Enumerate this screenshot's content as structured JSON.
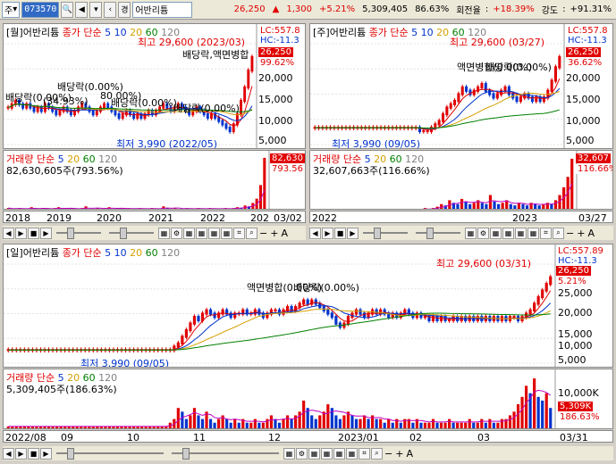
{
  "toolbar": {
    "mode": "주",
    "code": "073570",
    "icon_badge": "경",
    "name": "어반리튬",
    "price": "26,250",
    "arrow": "▲",
    "change": "1,300",
    "rate": "+5.21%",
    "volume": "5,309,405",
    "vol_ratio": "86.63%",
    "turnover_label": "회전율",
    "turnover": "+18.39%",
    "strength_label": "강도",
    "strength": "+91.31%"
  },
  "panels": {
    "monthly": {
      "title": "[월]어반리튬",
      "ma_label": "종가 단순",
      "ma": [
        "5",
        "10",
        "20",
        "60",
        "120"
      ],
      "high": "최고 29,600 (2023/03)",
      "low": "최저 3,990 (2022/05)",
      "anns": [
        "배당락,액면병합",
        "배당락(0.00%)",
        "배당락(0.00%)",
        "배당락(0.00%)",
        "배당락(0.00%)",
        "(34.93%)",
        "80.00%)"
      ],
      "lc": "LC:557.8",
      "hc": "HC:-11.3",
      "price_tag": "26,250",
      "pct_tag": "99.62%",
      "y": [
        "20,000",
        "15,000",
        "10,000",
        "5,000"
      ],
      "vol_title": "거래량",
      "vol_ma_label": "단순",
      "vol_ma": [
        "5",
        "20",
        "60",
        "120"
      ],
      "vol_value": "82,630,605주(793.56%)",
      "vol_tag": "82,630",
      "vol_pct_tag": "793.56",
      "x": [
        "2018",
        "2019",
        "2020",
        "2021",
        "2022",
        "202"
      ],
      "x_right": "03/02",
      "candles": [
        11,
        12,
        13,
        12,
        11,
        12,
        11,
        10,
        11,
        10,
        12,
        11,
        10,
        9,
        10,
        11,
        10,
        9,
        10,
        11,
        12,
        11,
        10,
        9,
        10,
        11,
        12,
        11,
        10,
        9,
        8,
        9,
        10,
        9,
        8,
        9,
        8,
        9,
        10,
        9,
        10,
        11,
        12,
        11,
        10,
        11,
        12,
        11,
        10,
        9,
        10,
        11,
        10,
        9,
        8,
        9,
        8,
        7,
        6,
        5,
        4,
        6,
        9,
        13,
        17,
        22,
        26
      ],
      "vols": [
        3,
        2,
        2,
        3,
        2,
        2,
        4,
        2,
        2,
        3,
        2,
        2,
        3,
        4,
        2,
        2,
        3,
        2,
        2,
        3,
        5,
        2,
        2,
        3,
        2,
        3,
        4,
        2,
        2,
        3,
        2,
        3,
        2,
        2,
        3,
        2,
        2,
        3,
        2,
        2,
        5,
        3,
        2,
        3,
        2,
        2,
        3,
        2,
        2,
        3,
        2,
        2,
        3,
        2,
        2,
        2,
        3,
        2,
        3,
        4,
        3,
        6,
        5,
        9,
        14,
        30,
        62
      ]
    },
    "weekly": {
      "title": "[주]어반리튬",
      "ma_label": "종가 단순",
      "ma": [
        "5",
        "10",
        "20",
        "60",
        "120"
      ],
      "high": "최고 29,600 (03/27)",
      "low": "최저 3,990 (09/05)",
      "anns": [
        "액면병합(0.00%)",
        "배당락(0.00%)"
      ],
      "lc": "LC:557.8",
      "hc": "HC:-11.3",
      "price_tag": "26,250",
      "pct_tag": "36.62%",
      "y": [
        "20,000",
        "15,000",
        "10,000",
        "5,000"
      ],
      "vol_title": "거래량",
      "vol_ma_label": "단순",
      "vol_ma": [
        "5",
        "20",
        "60",
        "120"
      ],
      "vol_value": "32,607,663주(116.66%)",
      "vol_tag": "32,607",
      "vol_pct_tag": "116.66%",
      "x": [
        "2022",
        "2023"
      ],
      "x_right": "03/27",
      "candles": [
        5,
        5,
        5,
        5,
        5,
        5,
        5,
        5,
        5,
        5,
        5,
        5,
        5,
        5,
        5,
        5,
        5,
        5,
        5,
        5,
        5,
        5,
        5,
        5,
        5,
        5,
        5,
        4,
        4,
        4,
        5,
        6,
        7,
        9,
        11,
        12,
        13,
        15,
        17,
        16,
        15,
        16,
        17,
        18,
        16,
        15,
        14,
        15,
        16,
        17,
        15,
        14,
        13,
        14,
        15,
        14,
        13,
        14,
        13,
        14,
        16,
        19,
        23,
        26
      ],
      "vols": [
        1,
        1,
        1,
        1,
        1,
        1,
        1,
        1,
        1,
        1,
        1,
        1,
        1,
        1,
        1,
        1,
        1,
        1,
        1,
        1,
        1,
        1,
        1,
        1,
        1,
        1,
        1,
        2,
        1,
        2,
        3,
        5,
        4,
        8,
        6,
        5,
        9,
        7,
        5,
        6,
        8,
        6,
        5,
        12,
        7,
        5,
        6,
        8,
        5,
        4,
        6,
        5,
        4,
        6,
        5,
        4,
        5,
        6,
        5,
        8,
        12,
        18,
        26,
        40
      ]
    },
    "daily": {
      "title": "[일]어반리튬",
      "ma_label": "종가 단순",
      "ma": [
        "5",
        "10",
        "20",
        "60",
        "120"
      ],
      "high": "최고 29,600 (03/31)",
      "low": "최저 3,990 (09/05)",
      "anns": [
        "액면병합(0.00%)",
        "배당락(0.00%)"
      ],
      "lc": "LC:557.89",
      "hc": "HC:-11.3",
      "price_tag": "26,250",
      "pct_tag": "5.21%",
      "y": [
        "25,000",
        "20,000",
        "15,000",
        "10,000",
        "5,000"
      ],
      "vol_title": "거래량",
      "vol_ma_label": "단순",
      "vol_ma": [
        "5",
        "20",
        "60",
        "120"
      ],
      "vol_value": "5,309,405주(186.63%)",
      "vol_tag": "5,309K",
      "vol_pct_tag": "186.63%",
      "vol_y": "10,000K",
      "x": [
        "2022/08",
        "09",
        "10",
        "11",
        "12",
        "2023/01",
        "02",
        "03"
      ],
      "x_right": "03/31",
      "candles": [
        4,
        4,
        4,
        4,
        4,
        4,
        4,
        4,
        4,
        4,
        4,
        4,
        4,
        4,
        4,
        4,
        4,
        4,
        4,
        4,
        4,
        4,
        4,
        4,
        4,
        4,
        4,
        4,
        4,
        4,
        4,
        4,
        4,
        4,
        4,
        4,
        4,
        4,
        4,
        4,
        4,
        5,
        6,
        8,
        10,
        12,
        14,
        13,
        15,
        16,
        15,
        14,
        15,
        16,
        15,
        14,
        15,
        15,
        16,
        15,
        15,
        16,
        15,
        14,
        15,
        16,
        16,
        15,
        16,
        17,
        16,
        17,
        18,
        19,
        18,
        19,
        18,
        17,
        16,
        15,
        14,
        12,
        11,
        12,
        14,
        15,
        16,
        15,
        14,
        15,
        16,
        15,
        16,
        15,
        14,
        15,
        14,
        15,
        16,
        15,
        14,
        15,
        14,
        14,
        13,
        14,
        13,
        14,
        13,
        13,
        14,
        13,
        14,
        13,
        14,
        13,
        14,
        13,
        14,
        13,
        14,
        13,
        14,
        13,
        14,
        14,
        13,
        14,
        15,
        16,
        18,
        20,
        22,
        24,
        26
      ],
      "vols": [
        1,
        1,
        1,
        1,
        1,
        1,
        1,
        1,
        1,
        1,
        1,
        1,
        1,
        1,
        1,
        1,
        1,
        1,
        1,
        1,
        1,
        1,
        1,
        1,
        1,
        1,
        1,
        1,
        1,
        1,
        1,
        1,
        1,
        1,
        1,
        1,
        1,
        1,
        1,
        1,
        2,
        3,
        6,
        5,
        3,
        4,
        6,
        4,
        3,
        5,
        3,
        2,
        3,
        4,
        3,
        2,
        3,
        2,
        3,
        2,
        2,
        3,
        2,
        2,
        3,
        4,
        3,
        2,
        3,
        4,
        3,
        4,
        5,
        8,
        6,
        4,
        3,
        4,
        5,
        7,
        6,
        4,
        3,
        4,
        5,
        4,
        3,
        3,
        4,
        3,
        4,
        3,
        3,
        2,
        3,
        2,
        3,
        2,
        3,
        3,
        2,
        3,
        2,
        2,
        2,
        3,
        2,
        2,
        2,
        3,
        2,
        2,
        2,
        2,
        3,
        2,
        2,
        3,
        2,
        3,
        2,
        2,
        3,
        3,
        4,
        5,
        7,
        9,
        12,
        10,
        14,
        9,
        8,
        10,
        6
      ]
    }
  },
  "nav": {
    "plus": "+",
    "minus": "−",
    "zoom_label": "A"
  }
}
